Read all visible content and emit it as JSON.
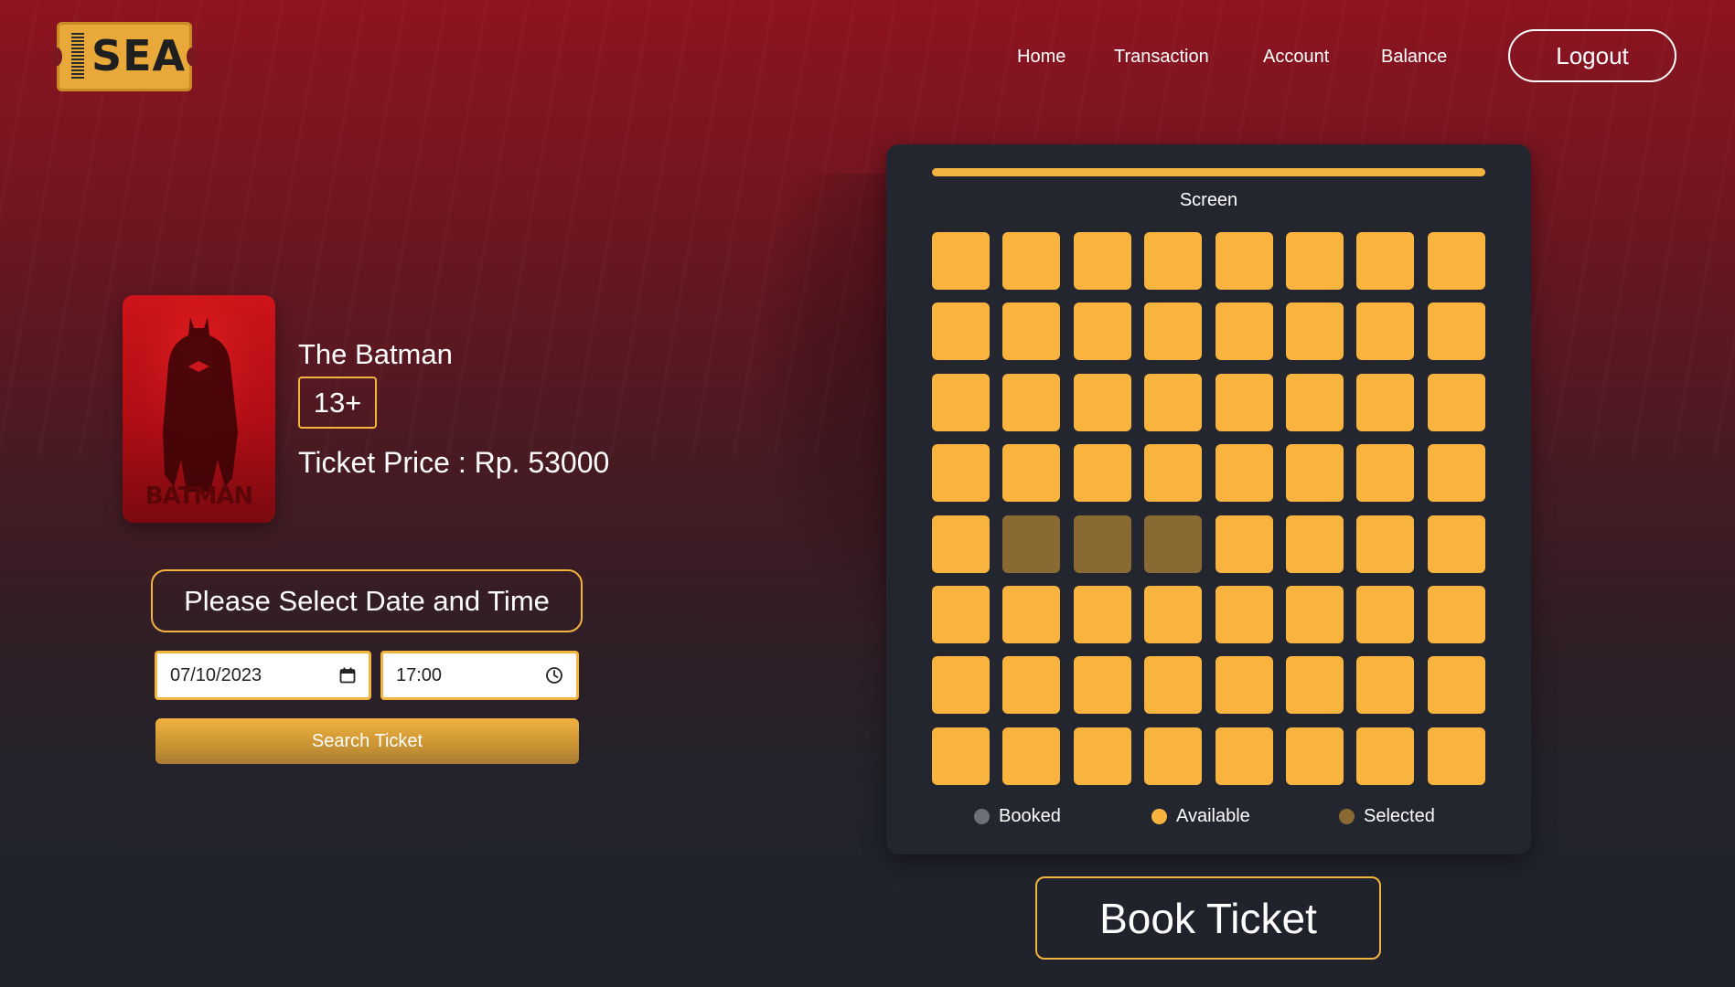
{
  "brand": {
    "logo_text": "SEA"
  },
  "nav": {
    "items": [
      {
        "label": "Home"
      },
      {
        "label": "Transaction"
      },
      {
        "label": "Account"
      },
      {
        "label": "Balance"
      }
    ],
    "logout_label": "Logout"
  },
  "movie": {
    "title": "The Batman",
    "poster_title": "BATMAN",
    "age_rating": "13+",
    "price_text": "Ticket Price : Rp. 53000"
  },
  "booking": {
    "select_prompt": "Please Select Date and Time",
    "date_value": "07/10/2023",
    "time_value": "17:00",
    "search_label": "Search Ticket",
    "book_label": "Book Ticket"
  },
  "seat_map": {
    "screen_label": "Screen",
    "rows": 8,
    "cols": 8,
    "selected_seats": [
      [
        4,
        1
      ],
      [
        4,
        2
      ],
      [
        4,
        3
      ]
    ],
    "booked_seats": [],
    "legend": [
      {
        "label": "Booked",
        "color": "#6f7178"
      },
      {
        "label": "Available",
        "color": "#f9b43f"
      },
      {
        "label": "Selected",
        "color": "#8a6a33"
      }
    ]
  },
  "colors": {
    "accent": "#f2b43e",
    "seat_available": "#f9b43f",
    "seat_selected": "#8a6a33",
    "panel_bg": "#23262e"
  }
}
